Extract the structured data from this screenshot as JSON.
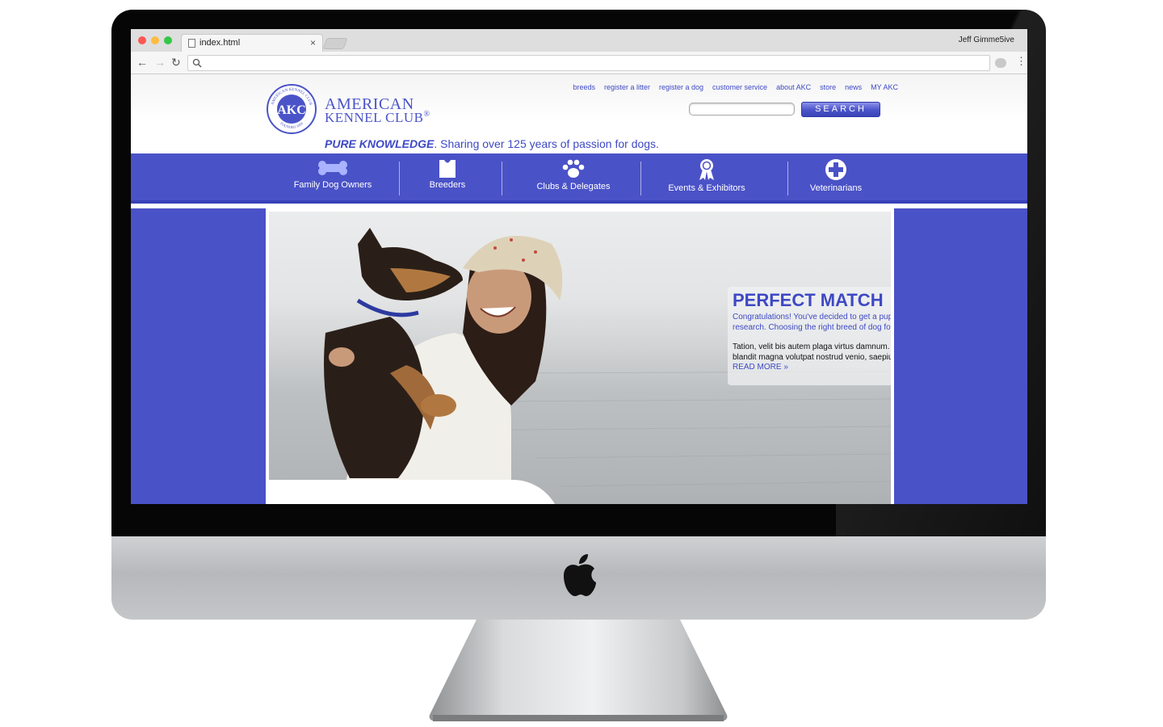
{
  "browser": {
    "tab_title": "index.html",
    "tab_close": "×",
    "profile_name": "Jeff Gimme5ive",
    "address": ""
  },
  "site": {
    "brand_line1": "AMERICAN",
    "brand_line2": "KENNEL CLUB",
    "registered": "®",
    "seal_text": "AKC",
    "seal_ring_top": "AMERICAN KENNEL CLUB",
    "seal_ring_bottom": "FOUNDED 1884",
    "tagline_strong": "PURE KNOWLEDGE",
    "tagline_rest": ". Sharing over 125 years of passion for dogs.",
    "top_links": [
      "breeds",
      "register a litter",
      "register a dog",
      "customer service",
      "about AKC",
      "store",
      "news",
      "MY AKC"
    ],
    "search_button": "SEARCH",
    "search_value": "",
    "nav": [
      {
        "label": "Family Dog Owners",
        "icon": "bone-icon"
      },
      {
        "label": "Breeders",
        "icon": "shirt-icon"
      },
      {
        "label": "Clubs & Delegates",
        "icon": "paw-icon"
      },
      {
        "label": "Events & Exhibitors",
        "icon": "ribbon-icon"
      },
      {
        "label": "Veterinarians",
        "icon": "medical-cross-icon"
      }
    ]
  },
  "promo": {
    "title": "PERFECT MATCH",
    "lead": "Congratulations! You've decided to get a puppy. First, you nedd to do some research. Choosing the right breed of dog for your lifestyle is now even easier",
    "body": "Tation, velit bis autem plaga virtus damnum. Imputo feugiat genitus adsum blandit magna volutpat nostrud venio, saepius.dignissim esca",
    "read_more": "READ MORE »"
  },
  "colors": {
    "brand_blue": "#4a52c7",
    "link_blue": "#3e49c4",
    "bezel": "#060606",
    "aluminum": "#c4c6c8"
  }
}
